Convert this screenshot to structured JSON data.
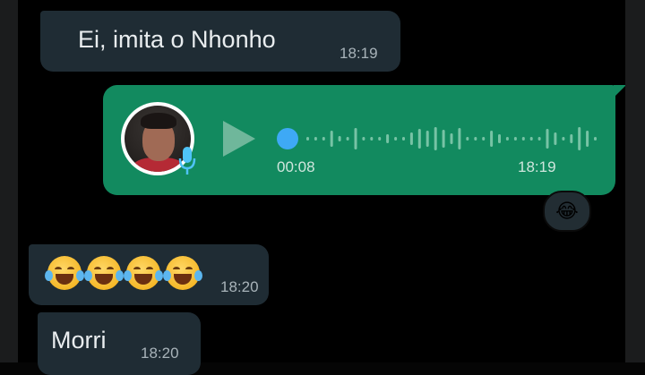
{
  "messages": [
    {
      "direction": "incoming",
      "text": "Ei, imita o Nhonho",
      "time": "18:19"
    },
    {
      "direction": "outgoing",
      "type": "voice",
      "duration": "00:08",
      "time": "18:19",
      "reaction": "😂"
    },
    {
      "direction": "incoming",
      "emoji": [
        "face-with-tears-of-joy",
        "face-with-tears-of-joy",
        "face-with-tears-of-joy",
        "face-with-tears-of-joy"
      ],
      "time": "18:20"
    },
    {
      "direction": "incoming",
      "text": "Morri",
      "time": "18:20"
    }
  ],
  "colors": {
    "background": "#000000",
    "incoming_bubble": "#1f2c34",
    "outgoing_bubble": "#128a5f",
    "voice_dot": "#3ea9f5"
  }
}
